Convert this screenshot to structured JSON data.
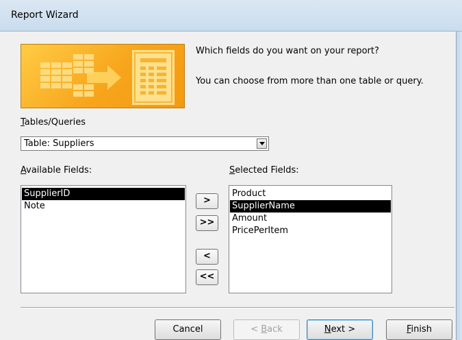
{
  "window": {
    "title": "Report Wizard"
  },
  "banner": {
    "question": "Which fields do you want on your report?",
    "hint": "You can choose from more than one table or query.",
    "graphic_icon": "report-wizard-graphic-icon",
    "accent_color": "#f7a51c"
  },
  "tables_queries": {
    "label_u": "T",
    "label_rest": "ables/Queries",
    "value": "Table: Suppliers",
    "dropdown_icon": "chevron-down-icon"
  },
  "available": {
    "label_u": "A",
    "label_rest": "vailable Fields:",
    "items": [
      "SupplierID",
      "Note"
    ],
    "selected_index": 0
  },
  "selected": {
    "label_u": "S",
    "label_rest": "elected Fields:",
    "items": [
      "Product",
      "SupplierName",
      "Amount",
      "PricePerItem"
    ],
    "selected_index": 1
  },
  "move_buttons": {
    "add": ">",
    "add_all": ">>",
    "remove": "<",
    "remove_all": "<<"
  },
  "buttons": {
    "cancel": "Cancel",
    "back_pre": "< ",
    "back_u": "B",
    "back_post": "ack",
    "next_u": "N",
    "next_post": "ext >",
    "finish_u": "F",
    "finish_post": "inish"
  }
}
